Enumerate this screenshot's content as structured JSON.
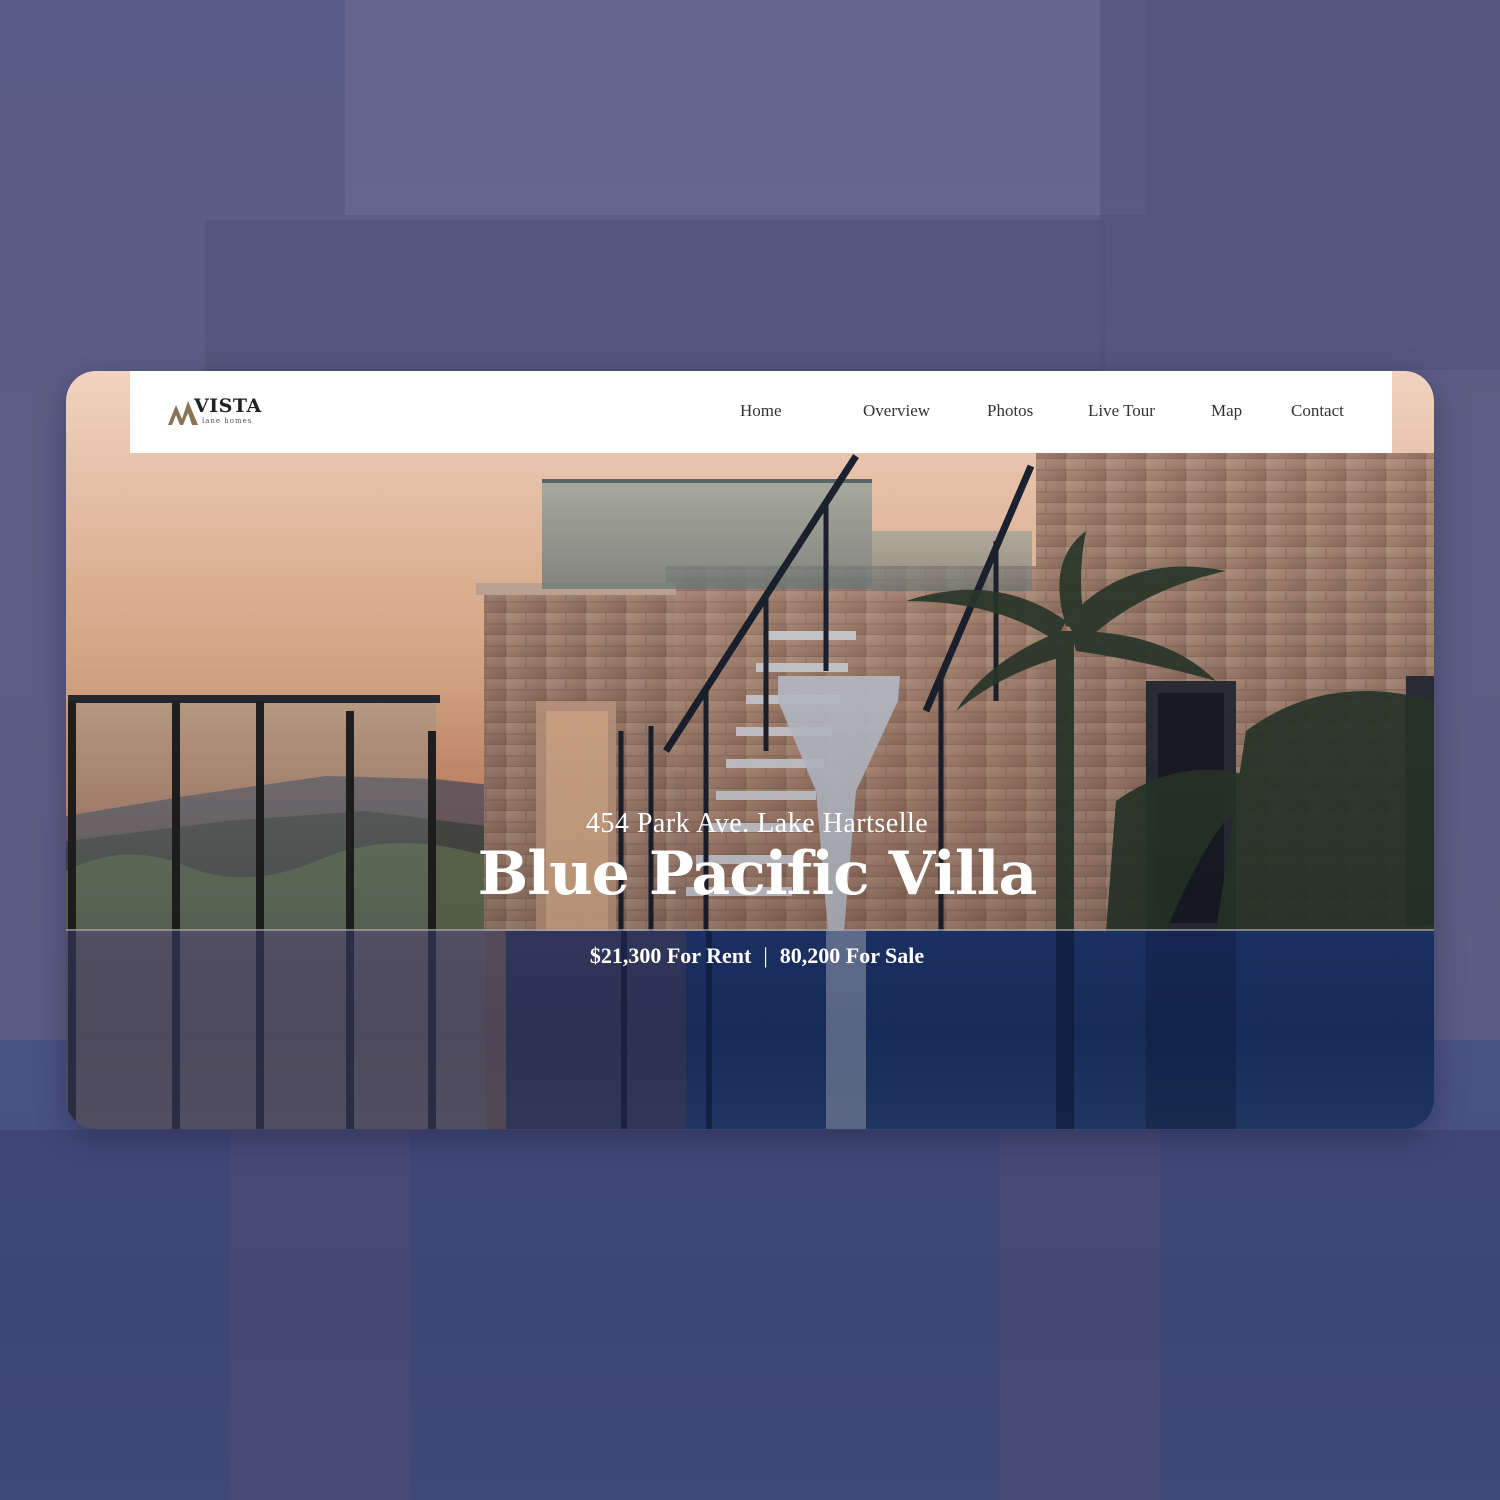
{
  "brand": {
    "name": "VISTA",
    "tagline": "lane homes"
  },
  "nav": {
    "items": [
      {
        "label": "Home"
      },
      {
        "label": "Overview"
      },
      {
        "label": "Photos"
      },
      {
        "label": "Live Tour"
      },
      {
        "label": "Map"
      },
      {
        "label": "Contact"
      }
    ]
  },
  "hero": {
    "address": "454 Park Ave. Lake Hartselle",
    "title": "Blue Pacific Villa",
    "rent_price": "$21,300 For Rent",
    "separator": "|",
    "sale_price": "80,200 For Sale"
  },
  "colors": {
    "page_background": "#565a88",
    "navbar": "#ffffff",
    "hero_text": "#ffffff",
    "logo_accent": "#8a7458"
  }
}
